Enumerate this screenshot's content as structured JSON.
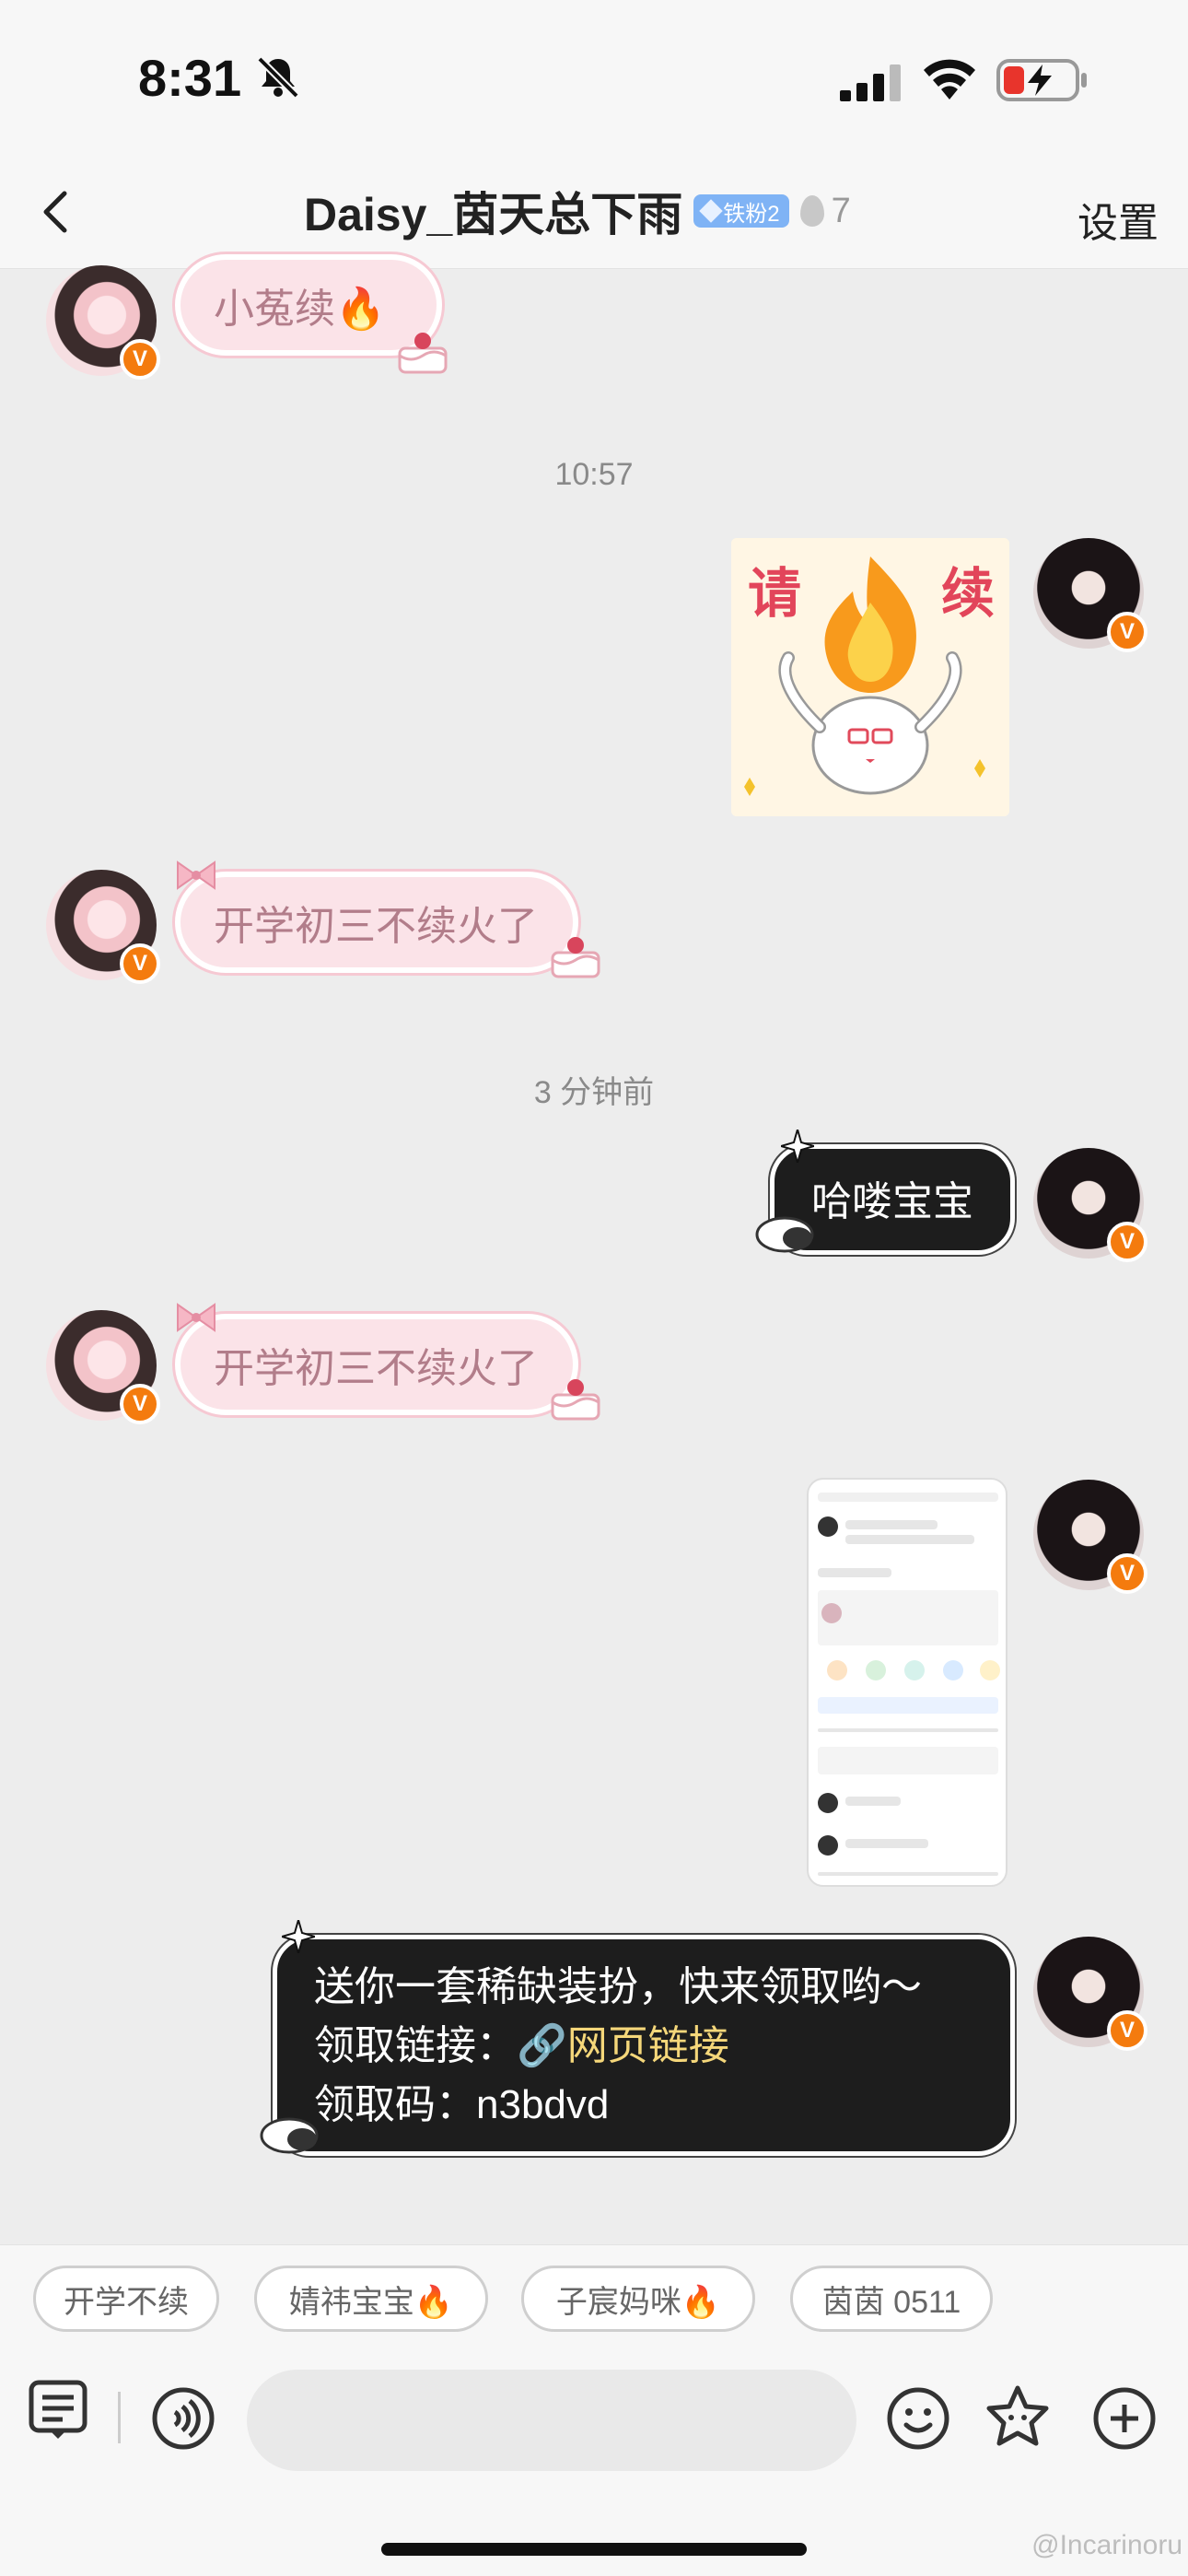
{
  "status": {
    "time": "8:31"
  },
  "header": {
    "title": "Daisy_茵天总下雨",
    "fan_badge": "铁粉2",
    "fire_count": "7",
    "settings_label": "设置"
  },
  "messages": [
    {
      "side": "left",
      "type": "text",
      "text": "小菟续🔥"
    },
    {
      "type": "timestamp",
      "text": "10:57"
    },
    {
      "side": "right",
      "type": "sticker",
      "text_left": "请",
      "text_right": "续"
    },
    {
      "side": "left",
      "type": "text",
      "text": "开学初三不续火了"
    },
    {
      "type": "timestamp",
      "text": "3 分钟前"
    },
    {
      "side": "right",
      "type": "text",
      "text": "哈喽宝宝"
    },
    {
      "side": "left",
      "type": "text",
      "text": "开学初三不续火了"
    },
    {
      "side": "right",
      "type": "image"
    },
    {
      "side": "right",
      "type": "text",
      "line1": "送你一套稀缺装扮，快来领取哟～",
      "line2_label": "领取链接：",
      "line2_link": "网页链接",
      "line3": "领取码：n3bdvd"
    }
  ],
  "quick_replies": [
    "开学不续",
    "婧祎宝宝🔥",
    "子宸妈咪🔥",
    "茵茵 0511"
  ],
  "watermark": "@Incarinoru",
  "colors": {
    "accent_orange": "#f47b0e",
    "badge_blue": "#7fb3f5",
    "pink_bubble": "#fbe3e8",
    "dark_bubble": "#1d1d1d"
  }
}
